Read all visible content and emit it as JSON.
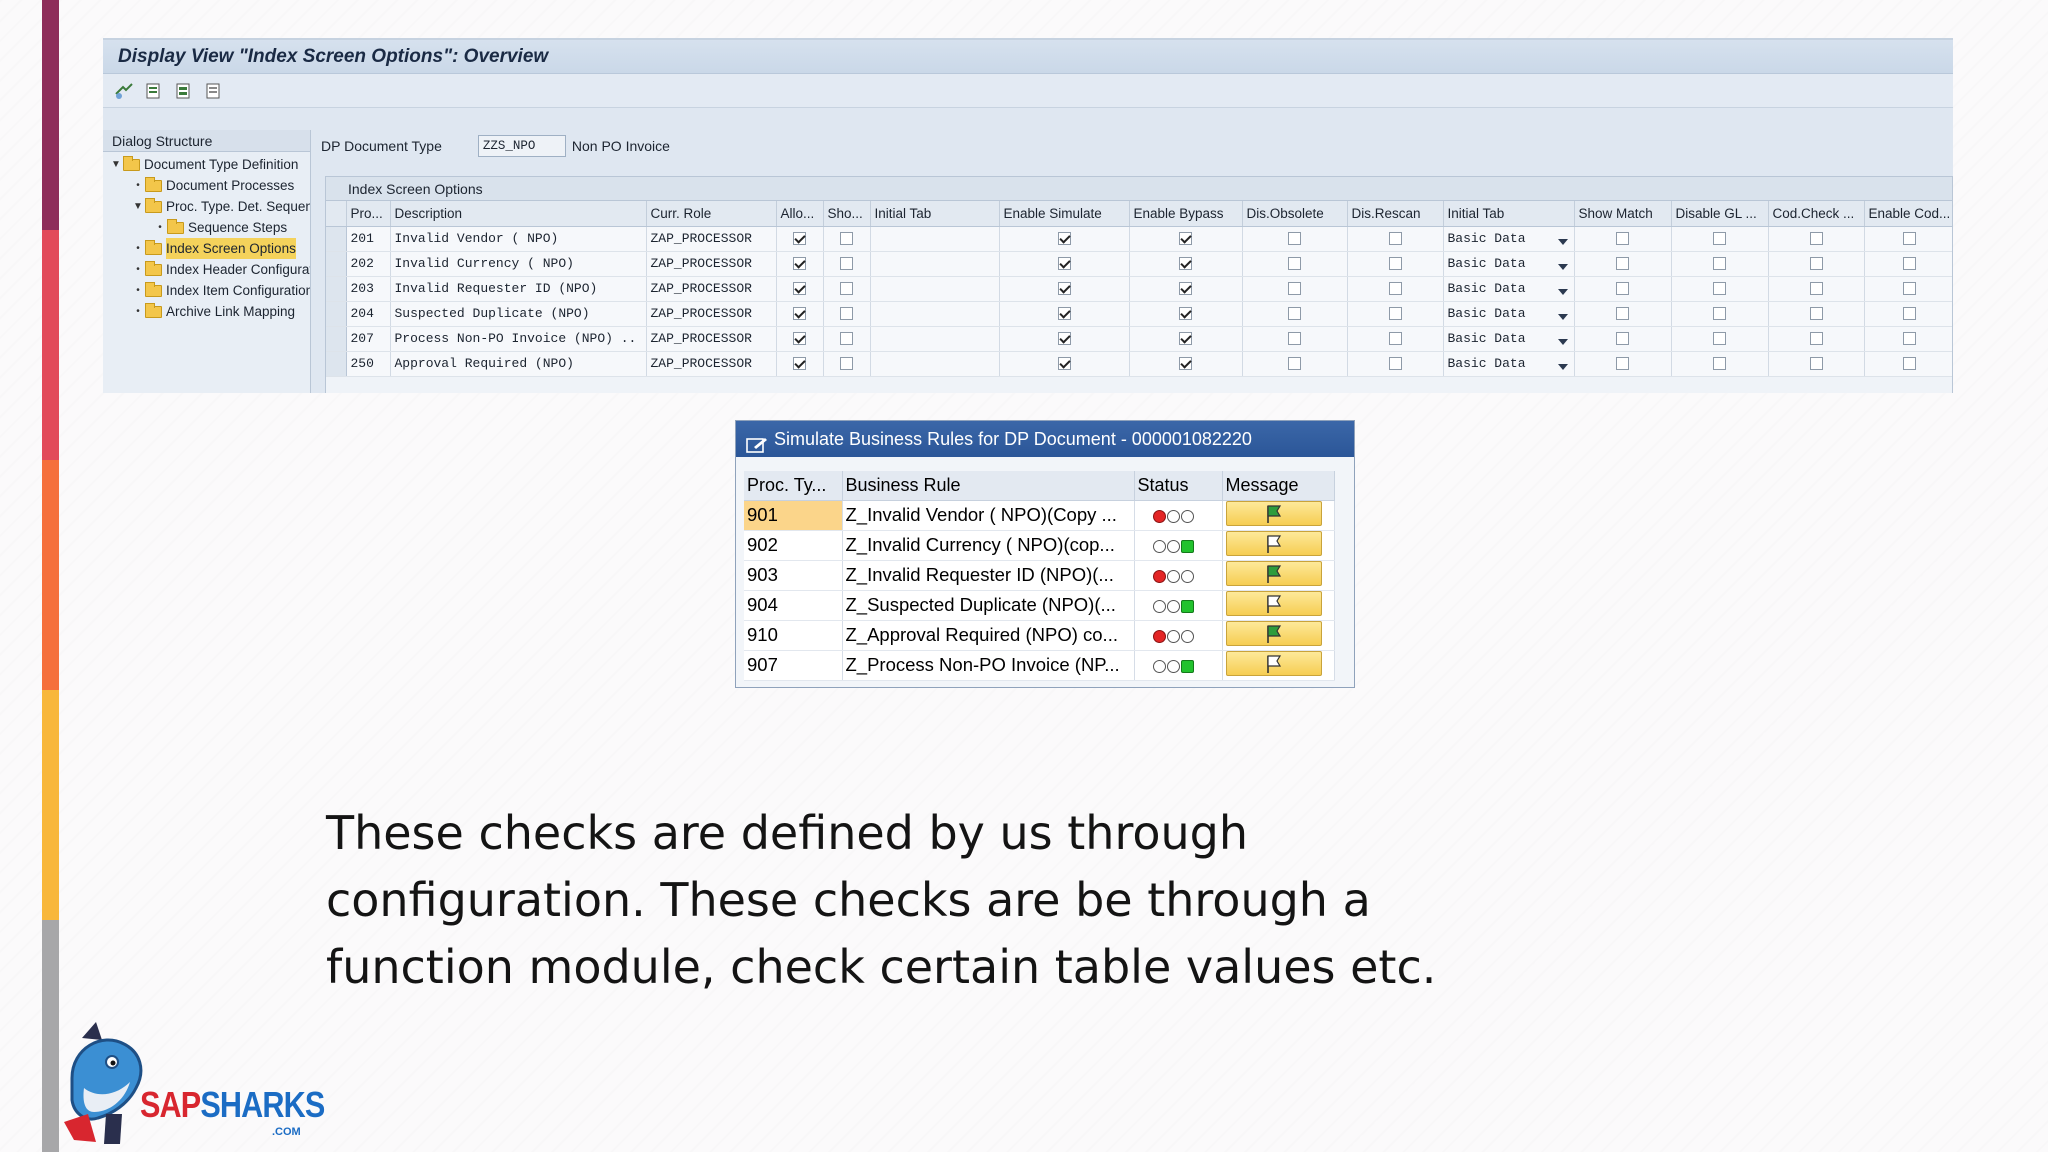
{
  "window": {
    "title": "Display View \"Index Screen Options\": Overview"
  },
  "toolbar": {
    "icons": [
      "other-view-icon",
      "details-icon",
      "select-all-icon",
      "deselect-all-icon"
    ]
  },
  "dialog_structure": {
    "title": "Dialog Structure",
    "items": [
      {
        "label": "Document Type Definition",
        "level": 0,
        "twisty": "open"
      },
      {
        "label": "Document Processes",
        "level": 1,
        "twisty": "leaf"
      },
      {
        "label": "Proc. Type. Det. Sequence",
        "level": 1,
        "twisty": "open"
      },
      {
        "label": "Sequence Steps",
        "level": 2,
        "twisty": "leaf"
      },
      {
        "label": "Index Screen Options",
        "level": 1,
        "twisty": "leaf",
        "selected": true
      },
      {
        "label": "Index Header Configuration",
        "level": 1,
        "twisty": "leaf"
      },
      {
        "label": "Index Item Configuration",
        "level": 1,
        "twisty": "leaf"
      },
      {
        "label": "Archive Link Mapping",
        "level": 1,
        "twisty": "leaf"
      }
    ]
  },
  "doc_type": {
    "label": "DP Document Type",
    "value": "ZZS_NPO",
    "description": "Non PO Invoice"
  },
  "index_screen_options": {
    "title": "Index Screen Options",
    "columns": [
      "Pro...",
      "Description",
      "Curr. Role",
      "Allo...",
      "Sho...",
      "Initial Tab",
      "Enable Simulate",
      "Enable Bypass",
      "Dis.Obsolete",
      "Dis.Rescan",
      "Initial Tab",
      "Show Match",
      "Disable GL ...",
      "Cod.Check ...",
      "Enable Cod..."
    ],
    "rows": [
      {
        "pro": "201",
        "description": "Invalid Vendor ( NPO)",
        "role": "ZAP_PROCESSOR",
        "allo": true,
        "sho": false,
        "initial_tab": "",
        "enable_simulate": true,
        "enable_bypass": true,
        "dis_obsolete": false,
        "dis_rescan": false,
        "initial_tab2": "Basic Data",
        "show_match": false,
        "disable_gl": false,
        "cod_check": false,
        "enable_cod": false
      },
      {
        "pro": "202",
        "description": "Invalid Currency ( NPO)",
        "role": "ZAP_PROCESSOR",
        "allo": true,
        "sho": false,
        "initial_tab": "",
        "enable_simulate": true,
        "enable_bypass": true,
        "dis_obsolete": false,
        "dis_rescan": false,
        "initial_tab2": "Basic Data",
        "show_match": false,
        "disable_gl": false,
        "cod_check": false,
        "enable_cod": false
      },
      {
        "pro": "203",
        "description": "Invalid Requester ID (NPO)",
        "role": "ZAP_PROCESSOR",
        "allo": true,
        "sho": false,
        "initial_tab": "",
        "enable_simulate": true,
        "enable_bypass": true,
        "dis_obsolete": false,
        "dis_rescan": false,
        "initial_tab2": "Basic Data",
        "show_match": false,
        "disable_gl": false,
        "cod_check": false,
        "enable_cod": false
      },
      {
        "pro": "204",
        "description": "Suspected Duplicate (NPO)",
        "role": "ZAP_PROCESSOR",
        "allo": true,
        "sho": false,
        "initial_tab": "",
        "enable_simulate": true,
        "enable_bypass": true,
        "dis_obsolete": false,
        "dis_rescan": false,
        "initial_tab2": "Basic Data",
        "show_match": false,
        "disable_gl": false,
        "cod_check": false,
        "enable_cod": false
      },
      {
        "pro": "207",
        "description": "Process Non-PO Invoice (NPO) ..",
        "role": "ZAP_PROCESSOR",
        "allo": true,
        "sho": false,
        "initial_tab": "",
        "enable_simulate": true,
        "enable_bypass": true,
        "dis_obsolete": false,
        "dis_rescan": false,
        "initial_tab2": "Basic Data",
        "show_match": false,
        "disable_gl": false,
        "cod_check": false,
        "enable_cod": false
      },
      {
        "pro": "250",
        "description": "Approval Required (NPO)",
        "role": "ZAP_PROCESSOR",
        "allo": true,
        "sho": false,
        "initial_tab": "",
        "enable_simulate": true,
        "enable_bypass": true,
        "dis_obsolete": false,
        "dis_rescan": false,
        "initial_tab2": "Basic Data",
        "show_match": false,
        "disable_gl": false,
        "cod_check": false,
        "enable_cod": false
      }
    ]
  },
  "simulate_popup": {
    "title": "Simulate Business Rules for DP Document - 000001082220",
    "columns": [
      "Proc. Ty...",
      "Business Rule",
      "Status",
      "Message"
    ],
    "rows": [
      {
        "proc_type": "901",
        "rule": "Z_Invalid Vendor ( NPO)(Copy ...",
        "status": "red",
        "message_icon": "green-flag-icon",
        "highlight": true
      },
      {
        "proc_type": "902",
        "rule": "Z_Invalid Currency ( NPO)(cop...",
        "status": "green",
        "message_icon": "white-flag-icon"
      },
      {
        "proc_type": "903",
        "rule": "Z_Invalid Requester ID (NPO)(...",
        "status": "red",
        "message_icon": "green-flag-icon"
      },
      {
        "proc_type": "904",
        "rule": "Z_Suspected Duplicate (NPO)(...",
        "status": "green",
        "message_icon": "white-flag-icon"
      },
      {
        "proc_type": "910",
        "rule": "Z_Approval Required (NPO) co...",
        "status": "red",
        "message_icon": "green-flag-icon"
      },
      {
        "proc_type": "907",
        "rule": "Z_Process Non-PO Invoice (NP...",
        "status": "green",
        "message_icon": "white-flag-icon"
      }
    ]
  },
  "body_text": {
    "lines": [
      "These checks are defined by us through",
      "configuration. These checks are be through a",
      "function module, check certain table values etc."
    ]
  },
  "logo": {
    "text_sap": "SAP",
    "text_sharks": "SHARKS",
    "text_com": ".COM"
  },
  "colors": {
    "accent_bar": [
      "#8e2d5a",
      "#e24a5a",
      "#f5703c",
      "#f8b73b",
      "#a7a7a9"
    ],
    "popup_header": "#2f5a9c",
    "status_red": "#e32525",
    "status_green": "#22c22e"
  }
}
